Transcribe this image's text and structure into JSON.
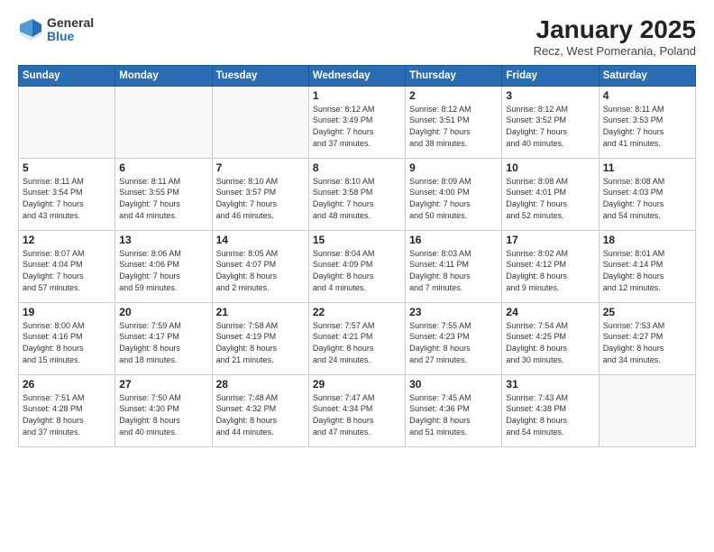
{
  "logo": {
    "general": "General",
    "blue": "Blue"
  },
  "title": "January 2025",
  "location": "Recz, West Pomerania, Poland",
  "days_header": [
    "Sunday",
    "Monday",
    "Tuesday",
    "Wednesday",
    "Thursday",
    "Friday",
    "Saturday"
  ],
  "weeks": [
    [
      {
        "day": "",
        "info": ""
      },
      {
        "day": "",
        "info": ""
      },
      {
        "day": "",
        "info": ""
      },
      {
        "day": "1",
        "info": "Sunrise: 8:12 AM\nSunset: 3:49 PM\nDaylight: 7 hours\nand 37 minutes."
      },
      {
        "day": "2",
        "info": "Sunrise: 8:12 AM\nSunset: 3:51 PM\nDaylight: 7 hours\nand 38 minutes."
      },
      {
        "day": "3",
        "info": "Sunrise: 8:12 AM\nSunset: 3:52 PM\nDaylight: 7 hours\nand 40 minutes."
      },
      {
        "day": "4",
        "info": "Sunrise: 8:11 AM\nSunset: 3:53 PM\nDaylight: 7 hours\nand 41 minutes."
      }
    ],
    [
      {
        "day": "5",
        "info": "Sunrise: 8:11 AM\nSunset: 3:54 PM\nDaylight: 7 hours\nand 43 minutes."
      },
      {
        "day": "6",
        "info": "Sunrise: 8:11 AM\nSunset: 3:55 PM\nDaylight: 7 hours\nand 44 minutes."
      },
      {
        "day": "7",
        "info": "Sunrise: 8:10 AM\nSunset: 3:57 PM\nDaylight: 7 hours\nand 46 minutes."
      },
      {
        "day": "8",
        "info": "Sunrise: 8:10 AM\nSunset: 3:58 PM\nDaylight: 7 hours\nand 48 minutes."
      },
      {
        "day": "9",
        "info": "Sunrise: 8:09 AM\nSunset: 4:00 PM\nDaylight: 7 hours\nand 50 minutes."
      },
      {
        "day": "10",
        "info": "Sunrise: 8:08 AM\nSunset: 4:01 PM\nDaylight: 7 hours\nand 52 minutes."
      },
      {
        "day": "11",
        "info": "Sunrise: 8:08 AM\nSunset: 4:03 PM\nDaylight: 7 hours\nand 54 minutes."
      }
    ],
    [
      {
        "day": "12",
        "info": "Sunrise: 8:07 AM\nSunset: 4:04 PM\nDaylight: 7 hours\nand 57 minutes."
      },
      {
        "day": "13",
        "info": "Sunrise: 8:06 AM\nSunset: 4:06 PM\nDaylight: 7 hours\nand 59 minutes."
      },
      {
        "day": "14",
        "info": "Sunrise: 8:05 AM\nSunset: 4:07 PM\nDaylight: 8 hours\nand 2 minutes."
      },
      {
        "day": "15",
        "info": "Sunrise: 8:04 AM\nSunset: 4:09 PM\nDaylight: 8 hours\nand 4 minutes."
      },
      {
        "day": "16",
        "info": "Sunrise: 8:03 AM\nSunset: 4:11 PM\nDaylight: 8 hours\nand 7 minutes."
      },
      {
        "day": "17",
        "info": "Sunrise: 8:02 AM\nSunset: 4:12 PM\nDaylight: 8 hours\nand 9 minutes."
      },
      {
        "day": "18",
        "info": "Sunrise: 8:01 AM\nSunset: 4:14 PM\nDaylight: 8 hours\nand 12 minutes."
      }
    ],
    [
      {
        "day": "19",
        "info": "Sunrise: 8:00 AM\nSunset: 4:16 PM\nDaylight: 8 hours\nand 15 minutes."
      },
      {
        "day": "20",
        "info": "Sunrise: 7:59 AM\nSunset: 4:17 PM\nDaylight: 8 hours\nand 18 minutes."
      },
      {
        "day": "21",
        "info": "Sunrise: 7:58 AM\nSunset: 4:19 PM\nDaylight: 8 hours\nand 21 minutes."
      },
      {
        "day": "22",
        "info": "Sunrise: 7:57 AM\nSunset: 4:21 PM\nDaylight: 8 hours\nand 24 minutes."
      },
      {
        "day": "23",
        "info": "Sunrise: 7:55 AM\nSunset: 4:23 PM\nDaylight: 8 hours\nand 27 minutes."
      },
      {
        "day": "24",
        "info": "Sunrise: 7:54 AM\nSunset: 4:25 PM\nDaylight: 8 hours\nand 30 minutes."
      },
      {
        "day": "25",
        "info": "Sunrise: 7:53 AM\nSunset: 4:27 PM\nDaylight: 8 hours\nand 34 minutes."
      }
    ],
    [
      {
        "day": "26",
        "info": "Sunrise: 7:51 AM\nSunset: 4:28 PM\nDaylight: 8 hours\nand 37 minutes."
      },
      {
        "day": "27",
        "info": "Sunrise: 7:50 AM\nSunset: 4:30 PM\nDaylight: 8 hours\nand 40 minutes."
      },
      {
        "day": "28",
        "info": "Sunrise: 7:48 AM\nSunset: 4:32 PM\nDaylight: 8 hours\nand 44 minutes."
      },
      {
        "day": "29",
        "info": "Sunrise: 7:47 AM\nSunset: 4:34 PM\nDaylight: 8 hours\nand 47 minutes."
      },
      {
        "day": "30",
        "info": "Sunrise: 7:45 AM\nSunset: 4:36 PM\nDaylight: 8 hours\nand 51 minutes."
      },
      {
        "day": "31",
        "info": "Sunrise: 7:43 AM\nSunset: 4:38 PM\nDaylight: 8 hours\nand 54 minutes."
      },
      {
        "day": "",
        "info": ""
      }
    ]
  ]
}
